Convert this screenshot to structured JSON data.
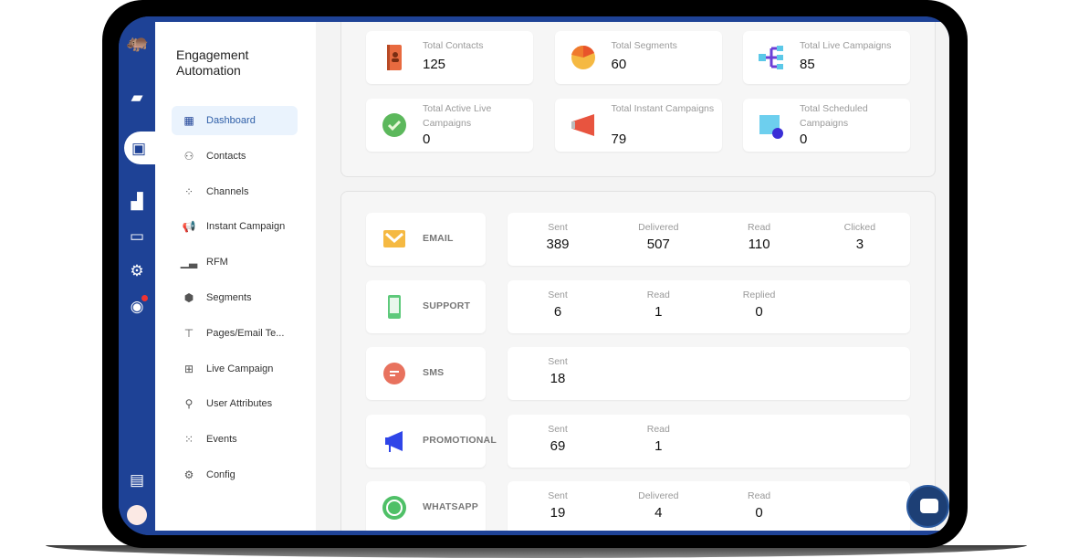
{
  "app": {
    "title": "Engagement Automation"
  },
  "rail": {
    "icons": [
      "hippo-logo-icon",
      "chat-icon",
      "presentation-icon",
      "growth-chart-icon",
      "monitor-settings-icon",
      "gear-icon",
      "bot-icon",
      "message-icon",
      "avatar"
    ]
  },
  "sidebar": {
    "items": [
      {
        "label": "Dashboard",
        "icon": "dashboard-icon",
        "active": true
      },
      {
        "label": "Contacts",
        "icon": "contacts-icon"
      },
      {
        "label": "Channels",
        "icon": "channels-icon"
      },
      {
        "label": "Instant Campaign",
        "icon": "megaphone-icon"
      },
      {
        "label": "RFM",
        "icon": "bar-chart-icon"
      },
      {
        "label": "Segments",
        "icon": "segments-icon"
      },
      {
        "label": "Pages/Email Te...",
        "icon": "paint-roller-icon"
      },
      {
        "label": "Live Campaign",
        "icon": "flow-icon"
      },
      {
        "label": "User Attributes",
        "icon": "users-icon"
      },
      {
        "label": "Events",
        "icon": "events-icon"
      },
      {
        "label": "Config",
        "icon": "config-icon"
      }
    ]
  },
  "summary": [
    {
      "label": "Total Contacts",
      "value": "125",
      "icon": "contact-book-icon"
    },
    {
      "label": "Total Segments",
      "value": "60",
      "icon": "pie-chart-icon"
    },
    {
      "label": "Total Live Campaigns",
      "value": "85",
      "icon": "flow-tree-icon"
    },
    {
      "label": "Total Active Live Campaigns",
      "value": "0",
      "icon": "check-circle-icon"
    },
    {
      "label": "Total Instant Campaigns",
      "value": "79",
      "icon": "megaphone-icon"
    },
    {
      "label": "Total Scheduled Campaigns",
      "value": "0",
      "icon": "calendar-clock-icon"
    }
  ],
  "channels": [
    {
      "name": "EMAIL",
      "icon": "email-icon",
      "stats": [
        {
          "label": "Sent",
          "value": "389"
        },
        {
          "label": "Delivered",
          "value": "507"
        },
        {
          "label": "Read",
          "value": "110"
        },
        {
          "label": "Clicked",
          "value": "3"
        }
      ]
    },
    {
      "name": "SUPPORT",
      "icon": "phone-icon",
      "stats": [
        {
          "label": "Sent",
          "value": "6"
        },
        {
          "label": "Read",
          "value": "1"
        },
        {
          "label": "Replied",
          "value": "0"
        }
      ]
    },
    {
      "name": "SMS",
      "icon": "sms-icon",
      "stats": [
        {
          "label": "Sent",
          "value": "18"
        }
      ]
    },
    {
      "name": "PROMOTIONAL",
      "icon": "promo-megaphone-icon",
      "stats": [
        {
          "label": "Sent",
          "value": "69"
        },
        {
          "label": "Read",
          "value": "1"
        }
      ]
    },
    {
      "name": "WHATSAPP",
      "icon": "whatsapp-icon",
      "stats": [
        {
          "label": "Sent",
          "value": "19"
        },
        {
          "label": "Delivered",
          "value": "4"
        },
        {
          "label": "Read",
          "value": "0"
        }
      ]
    }
  ],
  "colors": {
    "brand": "#1e4296",
    "chat_button": "#1d3f75"
  }
}
